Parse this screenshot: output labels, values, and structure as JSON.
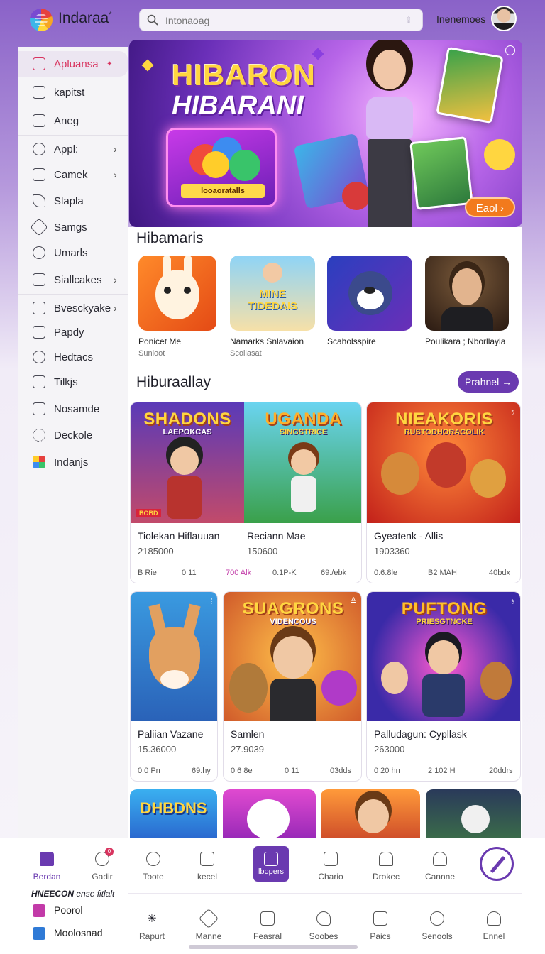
{
  "header": {
    "app_title": "Indaraa",
    "app_title_mark": "*",
    "search_placeholder": "Intonaoag",
    "user_name": "Inenemoes"
  },
  "sidebar": {
    "items": [
      {
        "label": "Apluansa",
        "icon": "calendar-icon",
        "active": true,
        "chevron": false
      },
      {
        "label": "kapitst",
        "icon": "document-icon",
        "active": false,
        "chevron": false
      },
      {
        "label": "Aneg",
        "icon": "share-icon",
        "active": false,
        "chevron": false
      },
      {
        "label": "Appl:",
        "icon": "camera-icon",
        "active": false,
        "chevron": true
      },
      {
        "label": "Camek",
        "icon": "grid-icon",
        "active": false,
        "chevron": true
      },
      {
        "label": "Slapla",
        "icon": "leaf-icon",
        "active": false,
        "chevron": false
      },
      {
        "label": "Samgs",
        "icon": "tag-icon",
        "active": false,
        "chevron": false
      },
      {
        "label": "Umarls",
        "icon": "chat-icon",
        "active": false,
        "chevron": false
      },
      {
        "label": "Siallcakes",
        "icon": "info-icon",
        "active": false,
        "chevron": true
      },
      {
        "label": "Bvesckyake",
        "icon": "box-icon",
        "active": false,
        "chevron": true
      },
      {
        "label": "Papdy",
        "icon": "image-icon",
        "active": false,
        "chevron": false
      },
      {
        "label": "Hedtacs",
        "icon": "heart-icon",
        "active": false,
        "chevron": false
      },
      {
        "label": "Tilkjs",
        "icon": "target-icon",
        "active": false,
        "chevron": false
      },
      {
        "label": "Nosamde",
        "icon": "bars-icon",
        "active": false,
        "chevron": false
      },
      {
        "label": "Deckole",
        "icon": "gear-icon",
        "active": false,
        "chevron": false
      },
      {
        "label": "Indanjs",
        "icon": "colorful-blocks-icon",
        "active": false,
        "chevron": false
      }
    ]
  },
  "hero": {
    "title_line1": "HIBARON",
    "title_line2": "HIBARANI",
    "box_label": "looaoratalls",
    "cta_label": "Eaol",
    "cta_arrow": "›"
  },
  "recommended": {
    "title": "Hibamaris",
    "items": [
      {
        "name": "Ponicet Me",
        "sub": "Sunioot"
      },
      {
        "name": "Namarks Snlavaion",
        "sub": "Scollasat",
        "thumb_text": "MINE TIDEDAIS"
      },
      {
        "name": "Scaholsspire",
        "sub": ""
      },
      {
        "name": "Poulikara ; Nborllayla",
        "sub": ""
      }
    ]
  },
  "games": {
    "title": "Hiburaallay",
    "more_label": "Prahnel →",
    "cards": [
      {
        "thumb_title": "SHADONS",
        "thumb_sub": "LAEPOKCAS",
        "name": "Tiolekan Hiflauuan",
        "count": "2185000",
        "meta": [
          "B Rie",
          "0 11",
          "700 Alk"
        ],
        "badge": "BOBD"
      },
      {
        "thumb_title": "UGANDA",
        "thumb_sub": "SINGSTRICE",
        "name": "Reciann Mae",
        "count": "150600",
        "meta": [
          "0.1P-K",
          "69./ebk"
        ]
      },
      {
        "thumb_title": "NIEAKORIS",
        "thumb_sub": "RUSTODHORACOLIK",
        "name": "Gyeatenk - Allis",
        "count": "1903360",
        "meta": [
          "0.6.8le",
          "B2 MAH",
          "40bdx"
        ],
        "corner": "♁"
      },
      {
        "thumb_title": "",
        "thumb_sub": "",
        "name": "Paliian Vazane",
        "count": "15.36000",
        "meta": [
          "0 0 Pn",
          "69.hy"
        ],
        "corner": "⁝"
      },
      {
        "thumb_title": "SUAGRONS",
        "thumb_sub": "VIDENCOUS",
        "name": "Samlen",
        "count": "27.9039",
        "meta": [
          "0 6 8e",
          "0 11",
          "03dds"
        ],
        "corner": "≙"
      },
      {
        "thumb_title": "PUFTONG",
        "thumb_sub": "PRIESGTNCKE",
        "name": "Palludagun: Cypllask",
        "count": "263000",
        "meta": [
          "0 20 hn",
          "2 102 H",
          "20ddrs"
        ],
        "corner": "♁"
      }
    ],
    "peek_titles": [
      "DHBDNS"
    ]
  },
  "bottom_nav": {
    "tabs_row1": [
      {
        "label": "Berdan",
        "icon": "home-icon",
        "active": true
      },
      {
        "label": "Gadir",
        "icon": "search-icon",
        "active": false,
        "badge": "0"
      },
      {
        "label": "Toote",
        "icon": "clock-icon",
        "active": false
      },
      {
        "label": "kecel",
        "icon": "list-icon",
        "active": false
      },
      {
        "label": "lbopers",
        "icon": "bookmark-icon",
        "active": false,
        "boxed": true
      },
      {
        "label": "Chario",
        "icon": "mail-icon",
        "active": false
      },
      {
        "label": "Drokec",
        "icon": "car-icon",
        "active": false
      },
      {
        "label": "Cannne",
        "icon": "user-icon",
        "active": false
      }
    ],
    "tabs_row2": [
      {
        "label": "Rapurt",
        "icon": "sparkle-icon"
      },
      {
        "label": "Manne",
        "icon": "tag-icon"
      },
      {
        "label": "Feasral",
        "icon": "square-icon"
      },
      {
        "label": "Soobes",
        "icon": "heart-icon"
      },
      {
        "label": "Paics",
        "icon": "calendar-icon"
      },
      {
        "label": "Senools",
        "icon": "compass-icon"
      },
      {
        "label": "Ennel",
        "icon": "person-icon"
      }
    ],
    "promo_bold": "HNEECON",
    "promo_text": "ense fitlalt",
    "mini_items": [
      {
        "label": "Poorol",
        "color": "#c23aa8"
      },
      {
        "label": "Moolosnad",
        "color": "#2f7ad6"
      }
    ]
  }
}
